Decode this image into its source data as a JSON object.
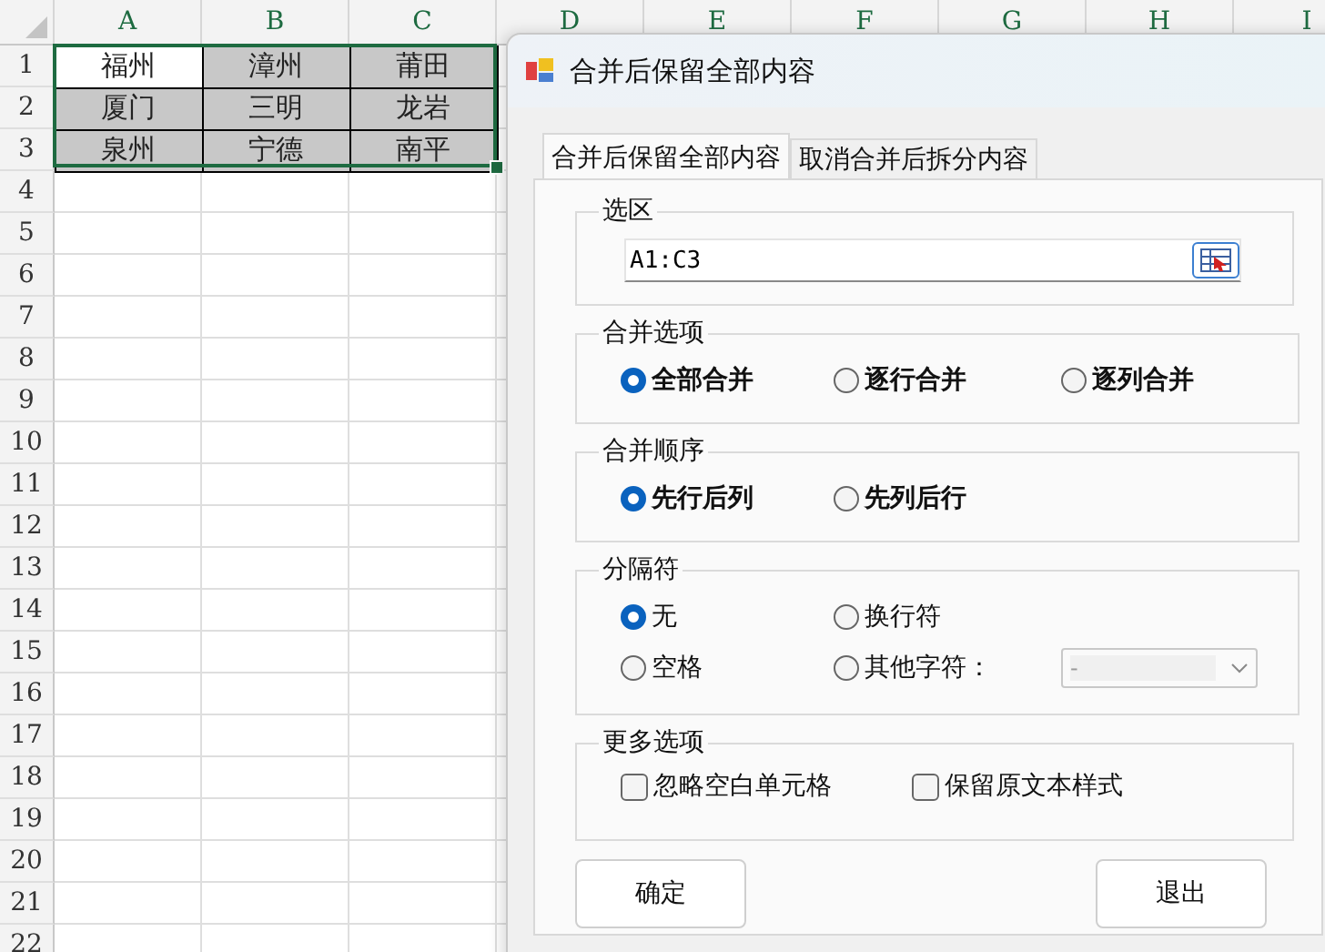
{
  "sheet": {
    "columns": [
      "A",
      "B",
      "C",
      "D",
      "E",
      "F",
      "G",
      "H",
      "I"
    ],
    "rows": [
      "1",
      "2",
      "3",
      "4",
      "5",
      "6",
      "7",
      "8",
      "9",
      "10",
      "11",
      "12",
      "13",
      "14",
      "15",
      "16",
      "17",
      "18",
      "19",
      "20",
      "21",
      "22"
    ],
    "cells": [
      [
        {
          "text": "福州",
          "active": true
        },
        {
          "text": "漳州",
          "active": false
        },
        {
          "text": "莆田",
          "active": false
        }
      ],
      [
        {
          "text": "厦门",
          "active": false
        },
        {
          "text": "三明",
          "active": false
        },
        {
          "text": "龙岩",
          "active": false
        }
      ],
      [
        {
          "text": "泉州",
          "active": false
        },
        {
          "text": "宁德",
          "active": false
        },
        {
          "text": "南平",
          "active": false
        }
      ]
    ]
  },
  "dialog": {
    "title": "合并后保留全部内容",
    "tabs": [
      {
        "label": "合并后保留全部内容",
        "selected": true
      },
      {
        "label": "取消合并后拆分内容",
        "selected": false
      }
    ],
    "selection": {
      "title": "选区",
      "value": "A1:C3"
    },
    "merge_options": {
      "title": "合并选项",
      "options": [
        {
          "label": "全部合并",
          "selected": true
        },
        {
          "label": "逐行合并",
          "selected": false
        },
        {
          "label": "逐列合并",
          "selected": false
        }
      ]
    },
    "merge_order": {
      "title": "合并顺序",
      "options": [
        {
          "label": "先行后列",
          "selected": true
        },
        {
          "label": "先列后行",
          "selected": false
        }
      ]
    },
    "separator": {
      "title": "分隔符",
      "options": [
        {
          "label": "无",
          "selected": true
        },
        {
          "label": "换行符",
          "selected": false
        },
        {
          "label": "空格",
          "selected": false
        },
        {
          "label": "其他字符：",
          "selected": false
        }
      ],
      "other_char": {
        "value": "-",
        "disabled": true
      }
    },
    "more_options": {
      "title": "更多选项",
      "checkboxes": [
        {
          "label": "忽略空白单元格",
          "checked": false
        },
        {
          "label": "保留原文本样式",
          "checked": false
        }
      ]
    },
    "buttons": [
      "确定",
      "退出"
    ]
  }
}
